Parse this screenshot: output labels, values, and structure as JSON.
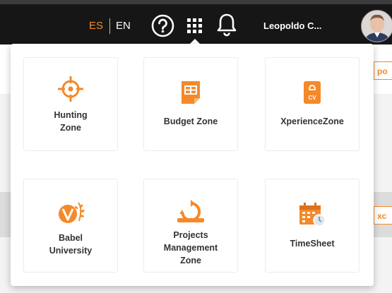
{
  "header": {
    "lang_es": "ES",
    "lang_en": "EN",
    "user_name": "Leopoldo C...",
    "accent_color": "#f4892a"
  },
  "apps": [
    {
      "label": "Hunting\nZone",
      "icon": "crosshair-target-icon"
    },
    {
      "label": "Budget Zone",
      "icon": "budget-document-icon"
    },
    {
      "label": "XperienceZone",
      "icon": "cv-document-icon"
    },
    {
      "label": "Babel\nUniversity",
      "icon": "babel-leaf-logo-icon"
    },
    {
      "label": "Projects\nManagement\nZone",
      "icon": "project-cycle-icon"
    },
    {
      "label": "TimeSheet",
      "icon": "calendar-clock-icon"
    }
  ],
  "background_edge": {
    "top_text": "po",
    "bottom_text": "xc"
  }
}
